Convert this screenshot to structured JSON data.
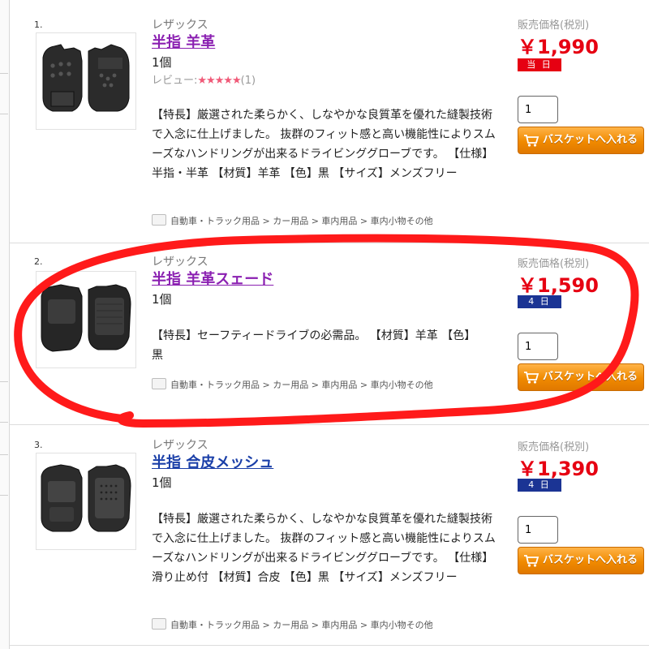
{
  "price_label": "販売価格(税別)",
  "basket_label": "バスケットへ入れる",
  "review_label": "レビュー:",
  "items": [
    {
      "index": "1.",
      "maker": "レザックス",
      "title": "半指 羊革",
      "qty_text": "1個",
      "review_stars": "★★★★★",
      "review_count": "(1)",
      "desc": "【特長】厳選された柔らかく、しなやかな良質革を優れた縫製技術で入念に仕上げました。 抜群のフィット感と高い機能性によりスムーズなハンドリングが出来るドライビンググローブです。 【仕様】半指・半革 【材質】羊革 【色】黒 【サイズ】メンズフリー",
      "categories": "自動車・トラック用品 > カー用品 > 車内用品 > 車内小物その他",
      "price": "￥1,990",
      "badge": "当 日",
      "badge_color": "#e60012",
      "qty_value": "1"
    },
    {
      "index": "2.",
      "maker": "レザックス",
      "title": "半指 羊革スェード",
      "qty_text": "1個",
      "desc": "【特長】セーフティードライブの必需品。 【材質】羊革 【色】黒",
      "categories": "自動車・トラック用品 > カー用品 > 車内用品 > 車内小物その他",
      "price": "￥1,590",
      "badge": "4 日",
      "badge_color": "#1b3494",
      "qty_value": "1"
    },
    {
      "index": "3.",
      "maker": "レザックス",
      "title": "半指 合皮メッシュ",
      "qty_text": "1個",
      "desc": "【特長】厳選された柔らかく、しなやかな良質革を優れた縫製技術で入念に仕上げました。 抜群のフィット感と高い機能性によりスムーズなハンドリングが出来るドライビンググローブです。 【仕様】滑り止め付 【材質】合皮 【色】黒 【サイズ】メンズフリー",
      "categories": "自動車・トラック用品 > カー用品 > 車内用品 > 車内小物その他",
      "price": "￥1,390",
      "badge": "4 日",
      "badge_color": "#1b3494",
      "qty_value": "1"
    }
  ],
  "colors": {
    "price_red": "#e60012",
    "title_purple": "#8a1fb1",
    "title_blue": "#1a3fa8",
    "button_orange": "#f08a00",
    "annotation_red": "#ff1a1a"
  },
  "icons": [
    "glove-image",
    "folder-icon",
    "cart-icon",
    "star-icon"
  ]
}
